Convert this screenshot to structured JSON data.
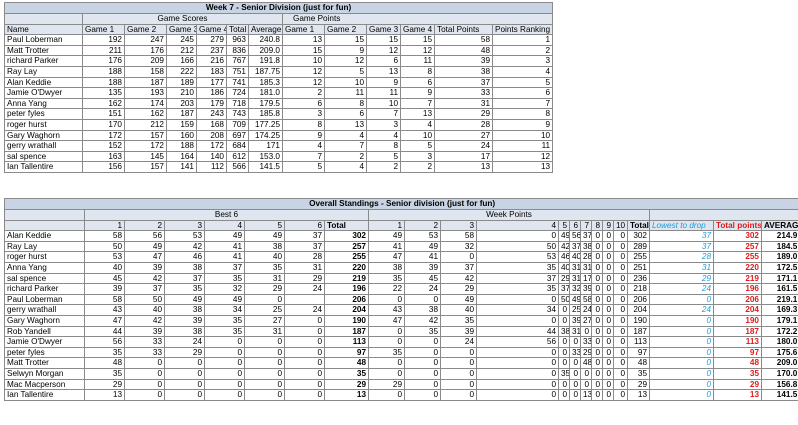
{
  "weekly": {
    "title": "Week 7 - Senior Division (just for fun)",
    "group_scores": "Game Scores",
    "group_points": "Game Points",
    "headers": [
      "Name",
      "Game 1",
      "Game 2",
      "Game 3",
      "Game 4",
      "Total",
      "Average",
      "Game 1",
      "Game 2",
      "Game 3",
      "Game 4",
      "Total Points",
      "Points Ranking"
    ],
    "rows": [
      [
        "Paul Loberman",
        "192",
        "247",
        "245",
        "279",
        "963",
        "240.8",
        "13",
        "15",
        "15",
        "15",
        "58",
        "1"
      ],
      [
        "Matt Trotter",
        "211",
        "176",
        "212",
        "237",
        "836",
        "209.0",
        "15",
        "9",
        "12",
        "12",
        "48",
        "2"
      ],
      [
        "richard Parker",
        "176",
        "209",
        "166",
        "216",
        "767",
        "191.8",
        "10",
        "12",
        "6",
        "11",
        "39",
        "3"
      ],
      [
        "Ray Lay",
        "188",
        "158",
        "222",
        "183",
        "751",
        "187.75",
        "12",
        "5",
        "13",
        "8",
        "38",
        "4"
      ],
      [
        "Alan Keddie",
        "188",
        "187",
        "189",
        "177",
        "741",
        "185.3",
        "12",
        "10",
        "9",
        "6",
        "37",
        "5"
      ],
      [
        "Jamie O'Dwyer",
        "135",
        "193",
        "210",
        "186",
        "724",
        "181.0",
        "2",
        "11",
        "11",
        "9",
        "33",
        "6"
      ],
      [
        "Anna Yang",
        "162",
        "174",
        "203",
        "179",
        "718",
        "179.5",
        "6",
        "8",
        "10",
        "7",
        "31",
        "7"
      ],
      [
        "peter fyles",
        "151",
        "162",
        "187",
        "243",
        "743",
        "185.8",
        "3",
        "6",
        "7",
        "13",
        "29",
        "8"
      ],
      [
        "roger hurst",
        "170",
        "212",
        "159",
        "168",
        "709",
        "177.25",
        "8",
        "13",
        "3",
        "4",
        "28",
        "9"
      ],
      [
        "Gary Waghorn",
        "172",
        "157",
        "160",
        "208",
        "697",
        "174.25",
        "9",
        "4",
        "4",
        "10",
        "27",
        "10"
      ],
      [
        "gerry wrathall",
        "152",
        "172",
        "188",
        "172",
        "684",
        "171",
        "4",
        "7",
        "8",
        "5",
        "24",
        "11"
      ],
      [
        "sal spence",
        "163",
        "145",
        "164",
        "140",
        "612",
        "153.0",
        "7",
        "2",
        "5",
        "3",
        "17",
        "12"
      ],
      [
        "Ian Tallentire",
        "156",
        "157",
        "141",
        "112",
        "566",
        "141.5",
        "5",
        "4",
        "2",
        "2",
        "13",
        "13"
      ]
    ]
  },
  "overall": {
    "title": "Overall Standings - Senior division (just for fun)",
    "group_best": "Best 6",
    "group_week": "Week Points",
    "headers": [
      "",
      "1",
      "2",
      "3",
      "4",
      "5",
      "6",
      "Total",
      "1",
      "2",
      "3",
      "4",
      "5",
      "6",
      "7",
      "8",
      "9",
      "10",
      "Total",
      "Lowest to drop",
      "Total points",
      "AVERAGE"
    ],
    "rows": [
      [
        "Alan Keddie",
        "58",
        "56",
        "53",
        "49",
        "49",
        "37",
        "302",
        "49",
        "53",
        "58",
        "0",
        "49",
        "56",
        "37",
        "0",
        "0",
        "0",
        "302",
        "37",
        "302",
        "214.9"
      ],
      [
        "Ray Lay",
        "50",
        "49",
        "42",
        "41",
        "38",
        "37",
        "257",
        "41",
        "49",
        "32",
        "50",
        "42",
        "37",
        "38",
        "0",
        "0",
        "0",
        "289",
        "37",
        "257",
        "184.5"
      ],
      [
        "roger hurst",
        "53",
        "47",
        "46",
        "41",
        "40",
        "28",
        "255",
        "47",
        "41",
        "0",
        "53",
        "46",
        "40",
        "28",
        "0",
        "0",
        "0",
        "255",
        "28",
        "255",
        "189.0"
      ],
      [
        "Anna Yang",
        "40",
        "39",
        "38",
        "37",
        "35",
        "31",
        "220",
        "38",
        "39",
        "37",
        "35",
        "40",
        "31",
        "31",
        "0",
        "0",
        "0",
        "251",
        "31",
        "220",
        "172.5"
      ],
      [
        "sal spence",
        "45",
        "42",
        "37",
        "35",
        "31",
        "29",
        "219",
        "35",
        "45",
        "42",
        "37",
        "29",
        "31",
        "17",
        "0",
        "0",
        "0",
        "236",
        "29",
        "219",
        "171.1"
      ],
      [
        "richard Parker",
        "39",
        "37",
        "35",
        "32",
        "29",
        "24",
        "196",
        "22",
        "24",
        "29",
        "35",
        "37",
        "32",
        "39",
        "0",
        "0",
        "0",
        "218",
        "24",
        "196",
        "161.5"
      ],
      [
        "Paul Loberman",
        "58",
        "50",
        "49",
        "49",
        "0",
        "",
        "206",
        "0",
        "0",
        "49",
        "0",
        "50",
        "49",
        "58",
        "0",
        "0",
        "0",
        "206",
        "0",
        "206",
        "219.1"
      ],
      [
        "gerry wrathall",
        "43",
        "40",
        "38",
        "34",
        "25",
        "24",
        "204",
        "43",
        "38",
        "40",
        "34",
        "0",
        "25",
        "24",
        "0",
        "0",
        "0",
        "204",
        "24",
        "204",
        "169.3"
      ],
      [
        "Gary Waghorn",
        "47",
        "42",
        "39",
        "35",
        "27",
        "0",
        "190",
        "47",
        "42",
        "35",
        "0",
        "0",
        "39",
        "27",
        "0",
        "0",
        "0",
        "190",
        "0",
        "190",
        "179.1"
      ],
      [
        "Rob Yandell",
        "44",
        "39",
        "38",
        "35",
        "31",
        "0",
        "187",
        "0",
        "35",
        "39",
        "44",
        "38",
        "31",
        "0",
        "0",
        "0",
        "0",
        "187",
        "0",
        "187",
        "172.2"
      ],
      [
        "Jamie O'Dwyer",
        "56",
        "33",
        "24",
        "0",
        "0",
        "0",
        "113",
        "0",
        "0",
        "24",
        "56",
        "0",
        "0",
        "33",
        "0",
        "0",
        "0",
        "113",
        "0",
        "113",
        "180.0"
      ],
      [
        "peter fyles",
        "35",
        "33",
        "29",
        "0",
        "0",
        "0",
        "97",
        "35",
        "0",
        "0",
        "0",
        "0",
        "33",
        "29",
        "0",
        "0",
        "0",
        "97",
        "0",
        "97",
        "175.6"
      ],
      [
        "Matt Trotter",
        "48",
        "0",
        "0",
        "0",
        "0",
        "0",
        "48",
        "0",
        "0",
        "0",
        "0",
        "0",
        "0",
        "48",
        "0",
        "0",
        "0",
        "48",
        "0",
        "48",
        "209.0"
      ],
      [
        "Selwyn Morgan",
        "35",
        "0",
        "0",
        "0",
        "0",
        "0",
        "35",
        "0",
        "0",
        "0",
        "0",
        "35",
        "0",
        "0",
        "0",
        "0",
        "0",
        "35",
        "0",
        "35",
        "170.0"
      ],
      [
        "Mac Macperson",
        "29",
        "0",
        "0",
        "0",
        "0",
        "0",
        "29",
        "29",
        "0",
        "0",
        "0",
        "0",
        "0",
        "0",
        "0",
        "0",
        "0",
        "29",
        "0",
        "29",
        "156.8"
      ],
      [
        "Ian Tallentire",
        "13",
        "0",
        "0",
        "0",
        "0",
        "0",
        "13",
        "0",
        "0",
        "0",
        "0",
        "0",
        "0",
        "13",
        "0",
        "0",
        "0",
        "13",
        "0",
        "13",
        "141.5"
      ]
    ]
  }
}
